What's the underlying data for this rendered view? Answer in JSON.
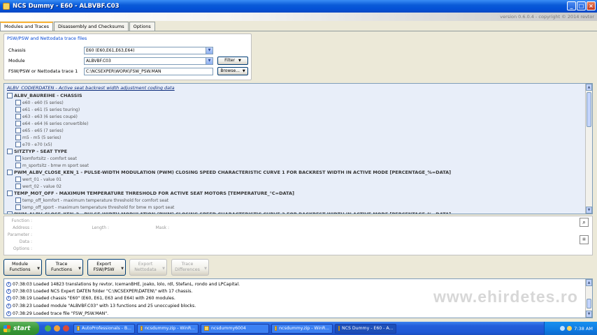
{
  "window": {
    "title": "NCS Dummy - E60 - ALBVBF.C03",
    "version": "version 0.6.0.4 - copyright © 2014 revtor"
  },
  "tabs": [
    {
      "label": "Modules and Traces"
    },
    {
      "label": "Disassembly and Checksums"
    },
    {
      "label": "Options"
    }
  ],
  "trace_files": {
    "group_title": "PSW/PSW and Nettodata trace files",
    "chassis_label": "Chassis",
    "chassis_value": "E60  (E60,E61,E63,E64)",
    "module_label": "Module",
    "module_value": "ALBVBF.C03",
    "filter_label": "Filter",
    "trace_label": "FSW/PSW or Nettodata trace 1",
    "trace_value": "C:\\NCSEXPER\\WORK\\FSW_PSW.MAN",
    "browse_label": "Browse..."
  },
  "tree": {
    "header": "ALBV_CODIERDATEN  -  Active seat backrest width adjustment coding data",
    "nodes": [
      {
        "level": 0,
        "text": "ALBV_BAUREIHE  -  CHASSIS"
      },
      {
        "level": 1,
        "text": "e60  -  e60 (5 series)"
      },
      {
        "level": 1,
        "text": "e61  -  e61 (5 series touring)"
      },
      {
        "level": 1,
        "text": "e63  -  e63 (6 series coupé)"
      },
      {
        "level": 1,
        "text": "e64  -  e64 (6 series convertible)"
      },
      {
        "level": 1,
        "text": "e65  -  e65 (7 series)"
      },
      {
        "level": 1,
        "text": "m5  -  m5 (5 series)"
      },
      {
        "level": 1,
        "text": "e70  -  e70 (x5)"
      },
      {
        "level": 0,
        "text": "SITZTYP  -  SEAT TYPE"
      },
      {
        "level": 1,
        "text": "komfortsitz  -  comfort seat"
      },
      {
        "level": 1,
        "text": "m_sportsitz  -  bmw m sport seat"
      },
      {
        "level": 0,
        "text": "PWM_ALBV_CLOSE_KEN_1  -  PULSE-WIDTH MODULATION (PWM) CLOSING SPEED CHARACTERISTIC CURVE 1 FOR BACKREST WIDTH IN ACTIVE MODE [PERCENTAGE_%=DATA]"
      },
      {
        "level": 1,
        "text": "wert_01  -  value 01"
      },
      {
        "level": 1,
        "text": "wert_02  -  value 02"
      },
      {
        "level": 0,
        "text": "TEMP_MOT_OFF  -  MAXIMUM TEMPERATURE THRESHOLD FOR ACTIVE SEAT MOTORS [TEMPERATURE_°C=DATA]"
      },
      {
        "level": 1,
        "text": "temp_off_komfort  -  maximum temperature threshold for comfort seat"
      },
      {
        "level": 1,
        "text": "temp_off_sport  -  maximum temperature threshold for bmw m sport seat"
      },
      {
        "level": 0,
        "text": "PWM_ALBV_CLOSE_KEN_2  -  PULSE-WIDTH MODULATION (PWM) CLOSING SPEED CHARACTERISTIC CURVE 2 FOR BACKREST WIDTH IN ACTIVE MODE [PERCENTAGE_%=DATA]"
      }
    ]
  },
  "details": {
    "function": "Function :",
    "address": "Address :",
    "parameter": "Parameter :",
    "data": "Data :",
    "options": "Options :",
    "length": "Length :",
    "mask": "Mask :"
  },
  "actions": [
    {
      "line1": "Module",
      "line2": "Functions",
      "enabled": true
    },
    {
      "line1": "Trace",
      "line2": "Functions",
      "enabled": true
    },
    {
      "line1": "Export",
      "line2": "FSW/PSW",
      "enabled": true
    },
    {
      "line1": "Export",
      "line2": "Nettodata",
      "enabled": false
    },
    {
      "line1": "Trace",
      "line2": "Differences",
      "enabled": false
    }
  ],
  "log": [
    "07:38:03  Loaded 14823 translations by revtor, IcemanBHE, joako, lolo, rdl, StefanL, rondo and LPCapital.",
    "07:38:03  Loaded NCS Expert DATEN folder \"C:\\NCSEXPER\\DATEN\\\" with 17 chassis.",
    "07:38:19  Loaded chassis \"E60\" (E60, E61, E63 and E64) with 260 modules.",
    "07:38:23  Loaded module \"ALBVBF.C03\" with 13 functions and 25 unoccupied blocks.",
    "07:38:29  Loaded trace file \"FSW_PSW.MAN\"."
  ],
  "taskbar": {
    "start_label": "start",
    "tasks": [
      "AutoProfessionals - B...",
      "ncsdummy.zip - WinR...",
      "ncsdummy6004",
      "ncsdummy.zip - WinR...",
      "NCS Dummy - E60 - A..."
    ],
    "clock": "7:38 AM"
  },
  "watermark": "www.ehirdetes.ro"
}
